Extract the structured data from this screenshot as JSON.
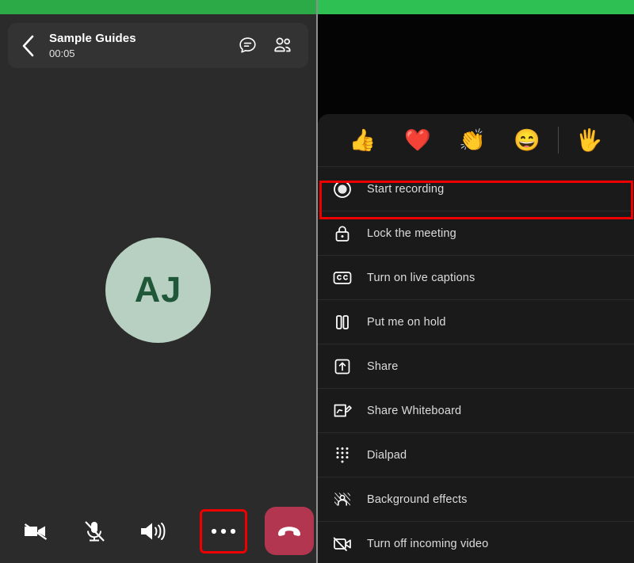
{
  "status_bars": {
    "left_color": "#2caa47",
    "right_color": "#2fc053"
  },
  "left_panel": {
    "header": {
      "back_icon": "chevron-left-icon",
      "title": "Sample Guides",
      "elapsed": "00:05",
      "chat_icon": "chat-bubble-icon",
      "participants_icon": "people-icon"
    },
    "stage": {
      "avatar_initials": "AJ",
      "avatar_bg": "#b7d0c1",
      "avatar_fg": "#1f5738"
    },
    "toolbar": {
      "items": [
        {
          "name": "camera-off-icon",
          "label": "Camera off"
        },
        {
          "name": "mic-off-icon",
          "label": "Microphone muted"
        },
        {
          "name": "speaker-icon",
          "label": "Speaker"
        },
        {
          "name": "more-options-icon",
          "label": "More options"
        }
      ],
      "hangup": {
        "name": "hang-up-icon",
        "label": "Leave call",
        "color": "#b33650"
      }
    }
  },
  "right_panel": {
    "reactions": [
      {
        "name": "thumbs-up-reaction",
        "glyph": "👍"
      },
      {
        "name": "heart-reaction",
        "glyph": "❤️"
      },
      {
        "name": "clap-reaction",
        "glyph": "👏"
      },
      {
        "name": "laugh-reaction",
        "glyph": "😄"
      },
      {
        "name": "raise-hand-reaction",
        "glyph": "🖐️"
      }
    ],
    "menu": [
      {
        "icon": "record-icon",
        "label": "Start recording"
      },
      {
        "icon": "lock-icon",
        "label": "Lock the meeting"
      },
      {
        "icon": "closed-captions-icon",
        "label": "Turn on live captions"
      },
      {
        "icon": "pause-icon",
        "label": "Put me on hold"
      },
      {
        "icon": "share-icon",
        "label": "Share"
      },
      {
        "icon": "whiteboard-icon",
        "label": "Share Whiteboard"
      },
      {
        "icon": "dialpad-icon",
        "label": "Dialpad"
      },
      {
        "icon": "background-effects-icon",
        "label": "Background effects"
      },
      {
        "icon": "video-off-icon",
        "label": "Turn off incoming video"
      }
    ],
    "highlight": {
      "target": "Start recording",
      "color": "#ee0000"
    }
  }
}
